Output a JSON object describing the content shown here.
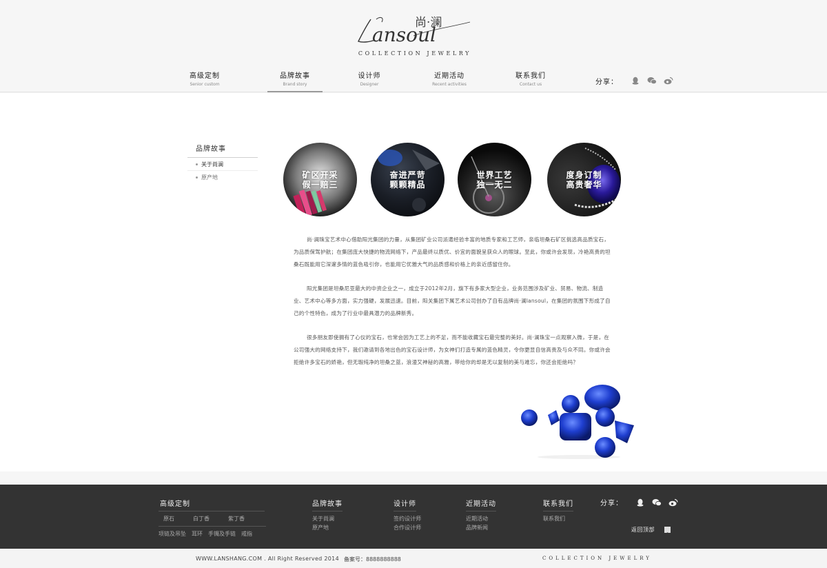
{
  "header": {
    "logo": {
      "script": "Lansoul",
      "cn": "尚·澜",
      "sub": "COLLECTION JEWELRY"
    },
    "nav": [
      {
        "cn": "高级定制",
        "en": "Senior custom"
      },
      {
        "cn": "品牌故事",
        "en": "Brand story",
        "active": true
      },
      {
        "cn": "设计师",
        "en": "Designer"
      },
      {
        "cn": "近期活动",
        "en": "Recent activities"
      },
      {
        "cn": "联系我们",
        "en": "Contact us"
      }
    ],
    "share": {
      "label": "分享：",
      "icons": [
        "qq-icon",
        "wechat-icon",
        "weibo-icon"
      ]
    }
  },
  "sidebar": {
    "title": "品牌故事",
    "items": [
      {
        "label": "关于尚澜"
      },
      {
        "label": "原产地"
      }
    ]
  },
  "features": [
    {
      "line1": "矿区开采",
      "line2": "假一赔三"
    },
    {
      "line1": "奋进严苛",
      "line2": "颗颗精品"
    },
    {
      "line1": "世界工艺",
      "line2": "独一无二"
    },
    {
      "line1": "度身订制",
      "line2": "高贵奢华"
    }
  ],
  "article": {
    "paragraphs": [
      "尚·澜珠宝艺术中心借助阳光集团的力量，从集团矿业公司派遣经验丰富的地质专家和工艺师，亲临坦桑石矿区挑选高品质宝石，为品质保驾护航；在集团庞大快捷的物流网络下，产品最终以质优、价宜的面貌呈获众人的眼球。至此，你或许会发现，冷艳高贵的坦桑石既能用它深邃多情的蓝色吸引你，也能用它优雅大气的品质感和价格上的亲近感留住你。",
      "阳光集团是坦桑尼亚最大的中资企业之一，成立于2012年2月，旗下有多家大型企业，业务范围涉及矿业、贸易、物流、制造业、艺术中心等多方面，实力强硬，发展迅速。目前，阳关集团下属艺术公司创办了自有品牌尚·澜lansoul，在集团的氛围下形成了自己的个性特色，成为了行业中最具潜力的品牌新秀。",
      "很多朋友即使拥有了心仪的宝石，也常会因为工艺上的不足，而不能收藏宝石最完整的美好。尚·澜珠宝一点观察入微，于是，在公司强大的网络支持下，我们邀请到各地出色的宝石设计师，为女神们打造专属的蓝色精灵，令你更显自信高贵及与众不同。你或许会拒绝许多宝石的娇艳，但无瑕纯净的坦桑之蓝，浪漫又神秘的高雅，带给你的却是无以复制的美与难忘，你还会拒绝吗？"
    ]
  },
  "footer": {
    "custom": {
      "title": "高级定制",
      "row1": [
        "原石",
        "白丁香",
        "紫丁香"
      ],
      "row2": [
        "项链及吊坠",
        "耳环",
        "手镯及手链",
        "戒指"
      ]
    },
    "brand": {
      "title": "品牌故事",
      "links": [
        "关于尚澜",
        "原产地"
      ]
    },
    "designer": {
      "title": "设计师",
      "links": [
        "签约设计师",
        "合作设计师"
      ]
    },
    "events": {
      "title": "近期活动",
      "links": [
        "近期活动",
        "品牌新闻"
      ]
    },
    "contact": {
      "title": "联系我们",
      "links": [
        "联系我们"
      ]
    },
    "share_label": "分享：",
    "back_to_top": "返回顶部"
  },
  "bottom": {
    "copyright": "WWW.LANSHANG.COM . All Right Reserved 2014",
    "icp": "备案号：8888888888",
    "brand": "COLLECTION JEWELRY"
  },
  "colors": {
    "footer_bg": "#333333",
    "page_bg": "#f6f6f6",
    "accent_blue": "#1a3fbf"
  }
}
